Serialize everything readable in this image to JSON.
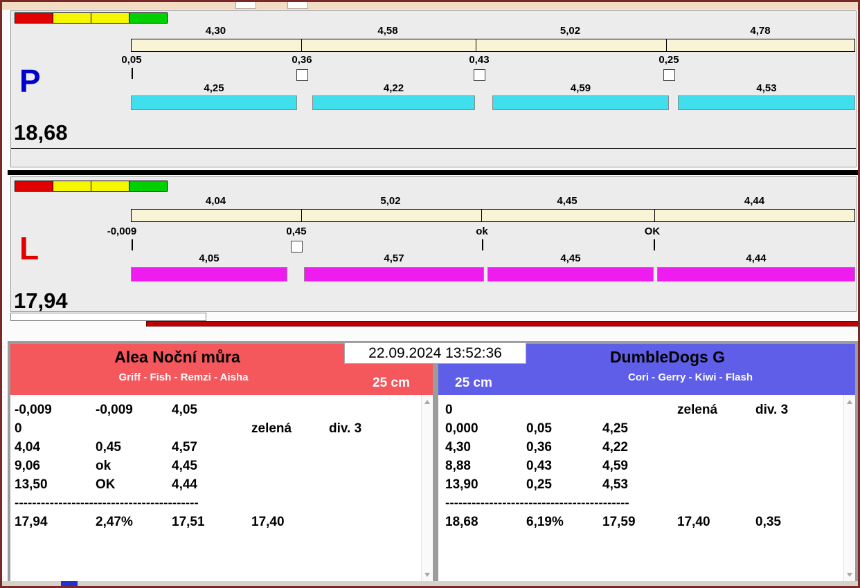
{
  "timestamp": "22.09.2024 13:52:36",
  "lanes": [
    {
      "letter": "P",
      "letter_color": "#0000cd",
      "total": "18,68",
      "bar_color": "#3fdfee",
      "splits": [
        "4,30",
        "4,58",
        "5,02",
        "4,78"
      ],
      "markers": [
        "0,05",
        "0,36",
        "0,43",
        "0,25"
      ],
      "dog_times": [
        "4,25",
        "4,22",
        "4,59",
        "4,53"
      ]
    },
    {
      "letter": "L",
      "letter_color": "#e00000",
      "total": "17,94",
      "bar_color": "#ee1cee",
      "splits": [
        "4,04",
        "5,02",
        "4,45",
        "4,44"
      ],
      "markers": [
        "-0,009",
        "0,45",
        "ok",
        "OK"
      ],
      "dog_times": [
        "4,05",
        "4,57",
        "4,45",
        "4,44"
      ]
    }
  ],
  "teams": {
    "left": {
      "name": "Alea Noční můra",
      "members": "Griff - Fish - Remzi - Aisha",
      "category": "25 cm",
      "header_color": "#f4575c",
      "rows": [
        [
          "-0,009",
          "-0,009",
          "4,05",
          "",
          ""
        ],
        [
          "0",
          "",
          "",
          "zelená",
          "div. 3"
        ],
        [
          "4,04",
          "0,45",
          "4,57",
          "",
          ""
        ],
        [
          "9,06",
          "ok",
          "4,45",
          "",
          ""
        ],
        [
          "13,50",
          "OK",
          "4,44",
          "",
          ""
        ]
      ],
      "separator": "------------------------------------------",
      "summary": [
        "17,94",
        "2,47%",
        "17,51",
        "17,40",
        ""
      ]
    },
    "right": {
      "name": "DumbleDogs G",
      "members": "Cori - Gerry - Kiwi - Flash",
      "category": "25 cm",
      "header_color": "#5e5ee8",
      "rows": [
        [
          "0",
          "",
          "",
          "zelená",
          "div. 3"
        ],
        [
          "0,000",
          "0,05",
          "4,25",
          "",
          ""
        ],
        [
          "4,30",
          "0,36",
          "4,22",
          "",
          ""
        ],
        [
          "8,88",
          "0,43",
          "4,59",
          "",
          ""
        ],
        [
          "13,90",
          "0,25",
          "4,53",
          "",
          ""
        ]
      ],
      "separator": "------------------------------------------",
      "summary": [
        "18,68",
        "6,19%",
        "17,59",
        "17,40",
        "0,35"
      ]
    }
  },
  "colors": {
    "indicators": [
      "#e10000",
      "#f6f600",
      "#f6f600",
      "#00cf00"
    ],
    "split_bar": "#f8f4d5",
    "progress_bar": "#c00000"
  }
}
